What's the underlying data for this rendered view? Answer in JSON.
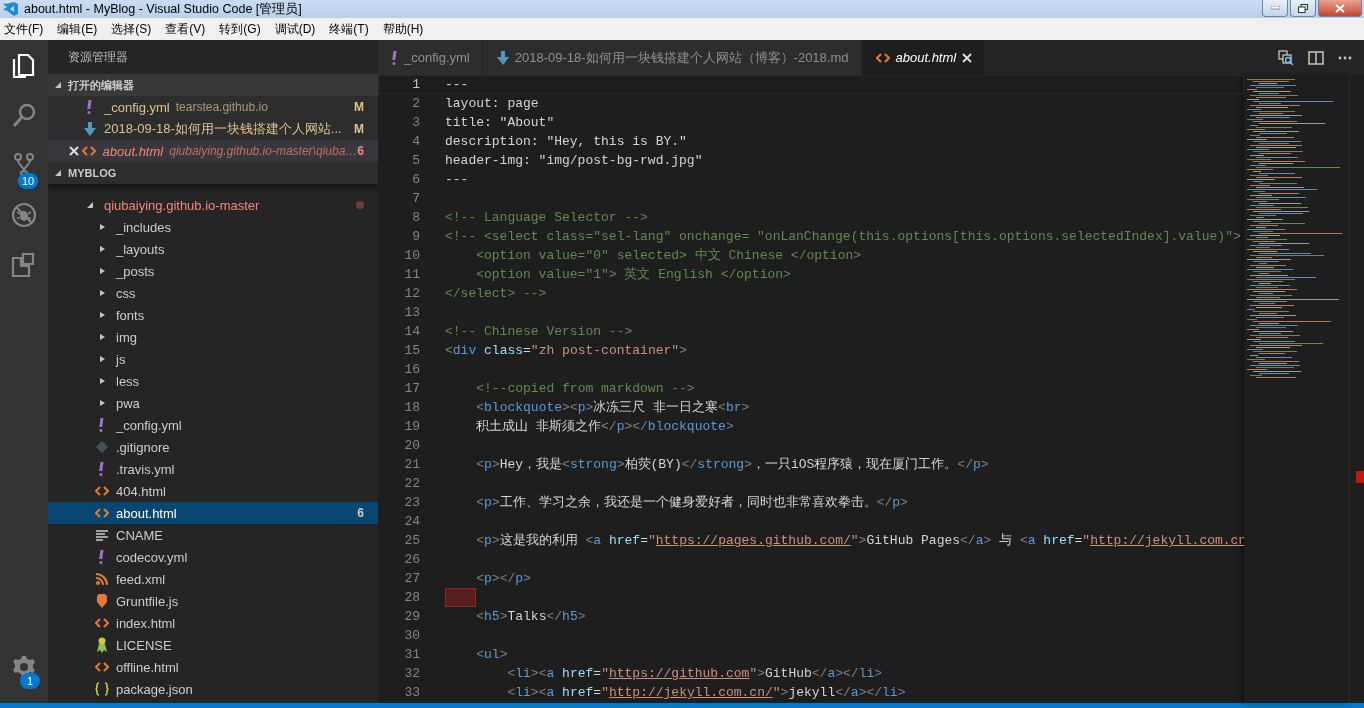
{
  "window": {
    "title": "about.html - MyBlog - Visual Studio Code [管理员]"
  },
  "menu": [
    "文件(F)",
    "编辑(E)",
    "选择(S)",
    "查看(V)",
    "转到(G)",
    "调试(D)",
    "终端(T)",
    "帮助(H)"
  ],
  "activity_bar": {
    "items": [
      {
        "kind": "explorer",
        "selected": true
      },
      {
        "kind": "search",
        "selected": false
      },
      {
        "kind": "scm",
        "selected": false,
        "badge": "10"
      },
      {
        "kind": "debug",
        "selected": false
      },
      {
        "kind": "extensions",
        "selected": false
      }
    ],
    "settings": {
      "badge": "1"
    }
  },
  "sidebar": {
    "title": "资源管理器",
    "open_editors": {
      "title": "打开的编辑器",
      "expanded": true,
      "items": [
        {
          "name": "_config.yml",
          "kind": "yaml",
          "description": "tearstea.github.io",
          "decoration": "M",
          "color": "#e2c08d",
          "selected": false,
          "preview": false
        },
        {
          "name": "2018-09-18-如何用一块钱搭建个人网站...",
          "kind": "markdown",
          "decoration": "M",
          "color": "#e2c08d",
          "selected": false,
          "preview": false
        },
        {
          "name": "about.html",
          "kind": "html",
          "description": "qiubaiying.github.io-master\\qiuba…",
          "decoration": "6",
          "color": "#f48771",
          "selected": true,
          "preview": true
        }
      ]
    },
    "folder": {
      "title": "MYBLOG",
      "expanded": true,
      "root": {
        "name": "qiubaiying.github.io-master",
        "color": "#f48771",
        "expanded": true,
        "children": [
          {
            "name": "_includes",
            "kind": "folder",
            "expanded": false,
            "selected": false
          },
          {
            "name": "_layouts",
            "kind": "folder",
            "expanded": false,
            "selected": false
          },
          {
            "name": "_posts",
            "kind": "folder",
            "expanded": false,
            "selected": false
          },
          {
            "name": "css",
            "kind": "folder",
            "expanded": false,
            "selected": false
          },
          {
            "name": "fonts",
            "kind": "folder",
            "expanded": false,
            "selected": false
          },
          {
            "name": "img",
            "kind": "folder",
            "expanded": false,
            "selected": false
          },
          {
            "name": "js",
            "kind": "folder",
            "expanded": false,
            "selected": false
          },
          {
            "name": "less",
            "kind": "folder",
            "expanded": false,
            "selected": false
          },
          {
            "name": "pwa",
            "kind": "folder",
            "expanded": false,
            "selected": false
          },
          {
            "name": "_config.yml",
            "kind": "yaml",
            "selected": false
          },
          {
            "name": ".gitignore",
            "kind": "git",
            "selected": false
          },
          {
            "name": ".travis.yml",
            "kind": "yaml",
            "selected": false
          },
          {
            "name": "404.html",
            "kind": "html",
            "selected": false
          },
          {
            "name": "about.html",
            "kind": "html",
            "selected": true,
            "decoration": "6"
          },
          {
            "name": "CNAME",
            "kind": "text",
            "selected": false
          },
          {
            "name": "codecov.yml",
            "kind": "yaml",
            "selected": false
          },
          {
            "name": "feed.xml",
            "kind": "rss",
            "selected": false
          },
          {
            "name": "Gruntfile.js",
            "kind": "grunt",
            "selected": false
          },
          {
            "name": "index.html",
            "kind": "html",
            "selected": false
          },
          {
            "name": "LICENSE",
            "kind": "license",
            "selected": false
          },
          {
            "name": "offline.html",
            "kind": "html",
            "selected": false
          },
          {
            "name": "package.json",
            "kind": "json",
            "selected": false
          }
        ]
      }
    }
  },
  "tabs": [
    {
      "label": "_config.yml",
      "kind": "yaml",
      "selected": false,
      "preview": false
    },
    {
      "label": "2018-09-18-如何用一块钱搭建个人网站（博客）-2018.md",
      "kind": "markdown",
      "selected": false,
      "preview": false
    },
    {
      "label": "about.html",
      "kind": "html",
      "selected": true,
      "preview": true
    }
  ],
  "editor": {
    "lines": [
      {
        "number": "1",
        "text": "---",
        "current": true,
        "error": false
      },
      {
        "number": "2",
        "text": "layout: page",
        "current": false,
        "error": false
      },
      {
        "number": "3",
        "text": "title: \"About\"",
        "current": false,
        "error": false
      },
      {
        "number": "4",
        "text": "description: \"Hey, this is BY.\"",
        "current": false,
        "error": false
      },
      {
        "number": "5",
        "text": "header-img: \"img/post-bg-rwd.jpg\"",
        "current": false,
        "error": false
      },
      {
        "number": "6",
        "text": "---",
        "current": false,
        "error": false
      },
      {
        "number": "7",
        "current": false,
        "error": false
      },
      {
        "number": "8",
        "text": "<!-- Language Selector -->",
        "current": false,
        "error": false
      },
      {
        "number": "9",
        "text": "<!-- <select class=\"sel-lang\" onchange= \"onLanChange(this.options[this.options.selectedIndex].value)\">",
        "current": false,
        "error": false
      },
      {
        "number": "10",
        "text": "    <option value=\"0\" selected> 中文 Chinese </option>",
        "current": false,
        "error": false
      },
      {
        "number": "11",
        "text": "    <option value=\"1\"> 英文 English </option>",
        "current": false,
        "error": false
      },
      {
        "number": "12",
        "text": "</select> -->",
        "current": false,
        "error": false
      },
      {
        "number": "13",
        "current": false,
        "error": false
      },
      {
        "number": "14",
        "text": "<!-- Chinese Version -->",
        "current": false,
        "error": false
      },
      {
        "number": "15",
        "text": "<div class=\"zh post-container\">",
        "current": false,
        "error": false
      },
      {
        "number": "16",
        "current": false,
        "error": false
      },
      {
        "number": "17",
        "text": "    <!--copied from markdown -->",
        "current": false,
        "error": false
      },
      {
        "number": "18",
        "text": "    <blockquote><p>冰冻三尺 非一日之寒<br>",
        "current": false,
        "error": false
      },
      {
        "number": "19",
        "text": "    积土成山 非斯须之作</p></blockquote>",
        "current": false,
        "error": false
      },
      {
        "number": "20",
        "current": false,
        "error": false
      },
      {
        "number": "21",
        "text": "    <p>Hey，我是<strong>柏荧(BY)</strong>，一只iOS程序猿，现在厦门工作。</p>",
        "current": false,
        "error": false
      },
      {
        "number": "22",
        "current": false,
        "error": false
      },
      {
        "number": "23",
        "text": "    <p>工作、学习之余，我还是一个健身爱好者，同时也非常喜欢拳击。</p>",
        "current": false,
        "error": false
      },
      {
        "number": "24",
        "current": false,
        "error": false
      },
      {
        "number": "25",
        "text": "    <p>这是我的利用 <a href=\"https://pages.github.com/\">GitHub Pages</a> 与 <a href=\"http://jekyll.com.cn",
        "current": false,
        "error": false
      },
      {
        "number": "26",
        "current": false,
        "error": false
      },
      {
        "number": "27",
        "text": "    <p></p>",
        "current": false,
        "error": false
      },
      {
        "number": "28",
        "current": false,
        "error": true
      },
      {
        "number": "29",
        "text": "    <h5>Talks</h5>",
        "current": false,
        "error": false
      },
      {
        "number": "30",
        "current": false,
        "error": false
      },
      {
        "number": "31",
        "text": "    <ul>",
        "current": false,
        "error": false
      },
      {
        "number": "32",
        "text": "        <li><a href=\"https://github.com\">GitHub</a></li>",
        "current": false,
        "error": false
      },
      {
        "number": "33",
        "text": "        <li><a href=\"http://jekyll.com.cn/\">jekyll</a></li>",
        "current": false,
        "error": false
      }
    ]
  }
}
